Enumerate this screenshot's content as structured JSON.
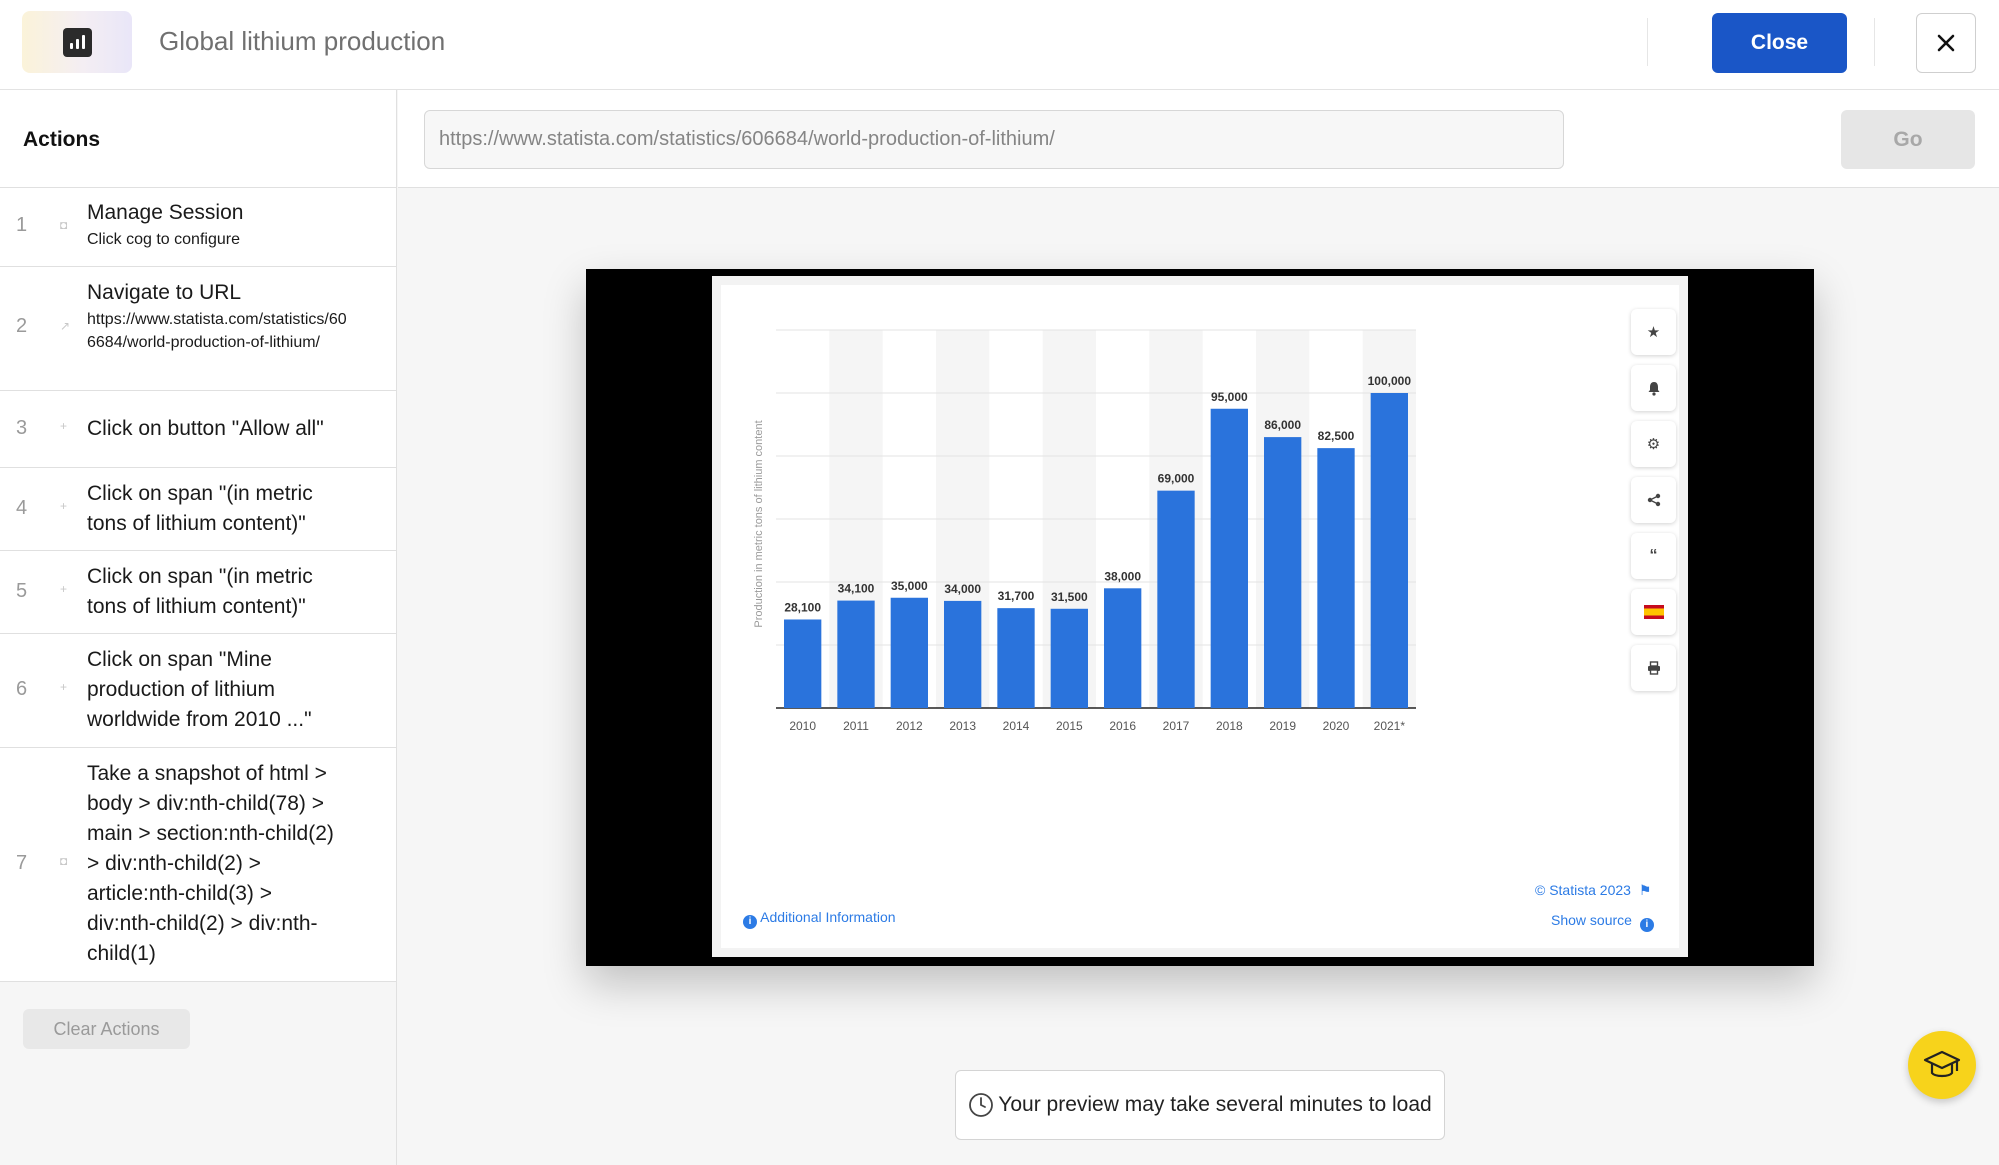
{
  "header": {
    "title": "Global lithium production",
    "close_label": "Close",
    "logo_icon": "bar-chart-icon",
    "dismiss_icon": "close-icon"
  },
  "sidebar": {
    "heading": "Actions",
    "items": [
      {
        "num": "1",
        "icon": "camera-icon",
        "label": "Manage Session",
        "sub": "Click cog to configure"
      },
      {
        "num": "2",
        "icon": "external-link-icon",
        "label": "Navigate to URL",
        "sub": "https://www.statista.com/statistics/606684/world-production-of-lithium/"
      },
      {
        "num": "3",
        "icon": "pointer-icon",
        "label": "Click on button \"Allow all\"",
        "sub": ""
      },
      {
        "num": "4",
        "icon": "pointer-icon",
        "label": "Click on span \"(in metric tons of lithium content)\"",
        "sub": ""
      },
      {
        "num": "5",
        "icon": "pointer-icon",
        "label": "Click on span \"(in metric tons of lithium content)\"",
        "sub": ""
      },
      {
        "num": "6",
        "icon": "pointer-icon",
        "label": "Click on span \"Mine production of lithium worldwide from 2010 ...\"",
        "sub": ""
      },
      {
        "num": "7",
        "icon": "camera-icon",
        "label": "Take a snapshot of html > body > div:nth-child(78) > main > section:nth-child(2) > div:nth-child(2) > article:nth-child(3) > div:nth-child(2) > div:nth-child(1)",
        "sub": ""
      }
    ],
    "clear_label": "Clear Actions"
  },
  "urlbar": {
    "value": "https://www.statista.com/statistics/606684/world-production-of-lithium/",
    "go_label": "Go"
  },
  "preview": {
    "copyright": "© Statista 2023",
    "additional_info": "Additional Information",
    "show_source": "Show source",
    "tools": [
      "star-icon",
      "bell-icon",
      "gear-icon",
      "share-icon",
      "quote-icon",
      "flag-spain-icon",
      "print-icon"
    ]
  },
  "chart_data": {
    "type": "bar",
    "ylabel": "Production in metric tons of lithium content",
    "categories": [
      "2010",
      "2011",
      "2012",
      "2013",
      "2014",
      "2015",
      "2016",
      "2017",
      "2018",
      "2019",
      "2020",
      "2021*"
    ],
    "values": [
      28100,
      34100,
      35000,
      34000,
      31700,
      31500,
      38000,
      69000,
      95000,
      86000,
      82500,
      100000
    ],
    "value_labels": [
      "28,100",
      "34,100",
      "35,000",
      "34,000",
      "31,700",
      "31,500",
      "38,000",
      "69,000",
      "95,000",
      "86,000",
      "82,500",
      "100,000"
    ],
    "ylim": [
      0,
      120000
    ],
    "grid": true,
    "bar_color": "#2a73dc"
  },
  "notice": "Your preview may take several minutes to load"
}
